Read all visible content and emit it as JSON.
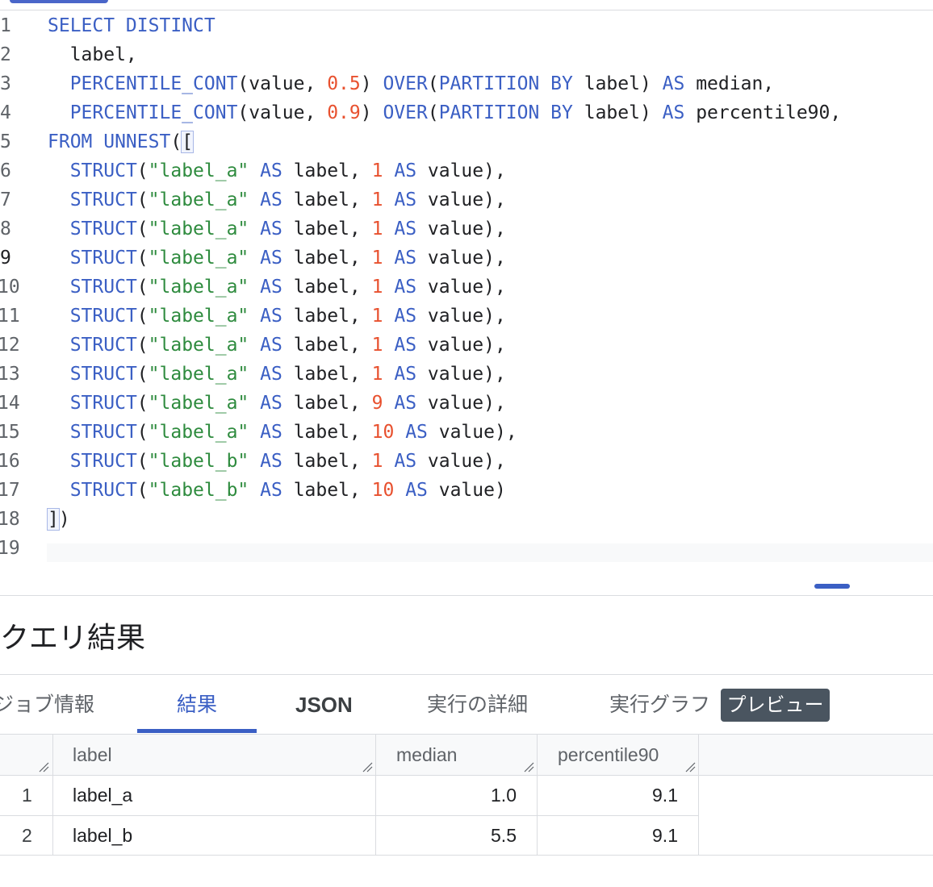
{
  "editor": {
    "line_numbers": [
      "1",
      "2",
      "3",
      "4",
      "5",
      "6",
      "7",
      "8",
      "9",
      "10",
      "11",
      "12",
      "13",
      "14",
      "15",
      "16",
      "17",
      "18",
      "19"
    ],
    "active_line": "9"
  },
  "results": {
    "title": "クエリ結果",
    "tabs": [
      {
        "label": "ジョブ情報"
      },
      {
        "label": "結果"
      },
      {
        "label": "JSON"
      },
      {
        "label": "実行の詳細"
      },
      {
        "label": "実行グラフ"
      }
    ],
    "preview_badge": "プレビュー",
    "columns": [
      "label",
      "median",
      "percentile90"
    ],
    "rows": [
      {
        "num": "1",
        "label": "label_a",
        "median": "1.0",
        "percentile90": "9.1"
      },
      {
        "num": "2",
        "label": "label_b",
        "median": "5.5",
        "percentile90": "9.1"
      }
    ]
  },
  "colors": {
    "keyword": "#3b5fc4",
    "number": "#e8512f",
    "string": "#2e8b3e",
    "accent": "#3b5fc4",
    "badge_bg": "#4a5560"
  },
  "code_lines": [
    [
      {
        "t": "kw",
        "v": "SELECT DISTINCT"
      }
    ],
    [
      {
        "t": "tx",
        "v": "  label,"
      }
    ],
    [
      {
        "t": "tx",
        "v": "  "
      },
      {
        "t": "kw",
        "v": "PERCENTILE_CONT"
      },
      {
        "t": "tx",
        "v": "(value, "
      },
      {
        "t": "num",
        "v": "0.5"
      },
      {
        "t": "tx",
        "v": ") "
      },
      {
        "t": "kw",
        "v": "OVER"
      },
      {
        "t": "tx",
        "v": "("
      },
      {
        "t": "kw",
        "v": "PARTITION BY"
      },
      {
        "t": "tx",
        "v": " label) "
      },
      {
        "t": "kw",
        "v": "AS"
      },
      {
        "t": "tx",
        "v": " median,"
      }
    ],
    [
      {
        "t": "tx",
        "v": "  "
      },
      {
        "t": "kw",
        "v": "PERCENTILE_CONT"
      },
      {
        "t": "tx",
        "v": "(value, "
      },
      {
        "t": "num",
        "v": "0.9"
      },
      {
        "t": "tx",
        "v": ") "
      },
      {
        "t": "kw",
        "v": "OVER"
      },
      {
        "t": "tx",
        "v": "("
      },
      {
        "t": "kw",
        "v": "PARTITION BY"
      },
      {
        "t": "tx",
        "v": " label) "
      },
      {
        "t": "kw",
        "v": "AS"
      },
      {
        "t": "tx",
        "v": " percentile90,"
      }
    ],
    [
      {
        "t": "kw",
        "v": "FROM UNNEST"
      },
      {
        "t": "tx",
        "v": "("
      },
      {
        "t": "br",
        "v": "["
      }
    ],
    [
      {
        "t": "tx",
        "v": "  "
      },
      {
        "t": "kw",
        "v": "STRUCT"
      },
      {
        "t": "tx",
        "v": "("
      },
      {
        "t": "str",
        "v": "\"label_a\""
      },
      {
        "t": "tx",
        "v": " "
      },
      {
        "t": "kw",
        "v": "AS"
      },
      {
        "t": "tx",
        "v": " label, "
      },
      {
        "t": "num",
        "v": "1"
      },
      {
        "t": "tx",
        "v": " "
      },
      {
        "t": "kw",
        "v": "AS"
      },
      {
        "t": "tx",
        "v": " value),"
      }
    ],
    [
      {
        "t": "tx",
        "v": "  "
      },
      {
        "t": "kw",
        "v": "STRUCT"
      },
      {
        "t": "tx",
        "v": "("
      },
      {
        "t": "str",
        "v": "\"label_a\""
      },
      {
        "t": "tx",
        "v": " "
      },
      {
        "t": "kw",
        "v": "AS"
      },
      {
        "t": "tx",
        "v": " label, "
      },
      {
        "t": "num",
        "v": "1"
      },
      {
        "t": "tx",
        "v": " "
      },
      {
        "t": "kw",
        "v": "AS"
      },
      {
        "t": "tx",
        "v": " value),"
      }
    ],
    [
      {
        "t": "tx",
        "v": "  "
      },
      {
        "t": "kw",
        "v": "STRUCT"
      },
      {
        "t": "tx",
        "v": "("
      },
      {
        "t": "str",
        "v": "\"label_a\""
      },
      {
        "t": "tx",
        "v": " "
      },
      {
        "t": "kw",
        "v": "AS"
      },
      {
        "t": "tx",
        "v": " label, "
      },
      {
        "t": "num",
        "v": "1"
      },
      {
        "t": "tx",
        "v": " "
      },
      {
        "t": "kw",
        "v": "AS"
      },
      {
        "t": "tx",
        "v": " value),"
      }
    ],
    [
      {
        "t": "tx",
        "v": "  "
      },
      {
        "t": "kw",
        "v": "STRUCT"
      },
      {
        "t": "tx",
        "v": "("
      },
      {
        "t": "str",
        "v": "\"label_a\""
      },
      {
        "t": "tx",
        "v": " "
      },
      {
        "t": "kw",
        "v": "AS"
      },
      {
        "t": "tx",
        "v": " label, "
      },
      {
        "t": "num",
        "v": "1"
      },
      {
        "t": "tx",
        "v": " "
      },
      {
        "t": "kw",
        "v": "AS"
      },
      {
        "t": "tx",
        "v": " value),"
      }
    ],
    [
      {
        "t": "tx",
        "v": "  "
      },
      {
        "t": "kw",
        "v": "STRUCT"
      },
      {
        "t": "tx",
        "v": "("
      },
      {
        "t": "str",
        "v": "\"label_a\""
      },
      {
        "t": "tx",
        "v": " "
      },
      {
        "t": "kw",
        "v": "AS"
      },
      {
        "t": "tx",
        "v": " label, "
      },
      {
        "t": "num",
        "v": "1"
      },
      {
        "t": "tx",
        "v": " "
      },
      {
        "t": "kw",
        "v": "AS"
      },
      {
        "t": "tx",
        "v": " value),"
      }
    ],
    [
      {
        "t": "tx",
        "v": "  "
      },
      {
        "t": "kw",
        "v": "STRUCT"
      },
      {
        "t": "tx",
        "v": "("
      },
      {
        "t": "str",
        "v": "\"label_a\""
      },
      {
        "t": "tx",
        "v": " "
      },
      {
        "t": "kw",
        "v": "AS"
      },
      {
        "t": "tx",
        "v": " label, "
      },
      {
        "t": "num",
        "v": "1"
      },
      {
        "t": "tx",
        "v": " "
      },
      {
        "t": "kw",
        "v": "AS"
      },
      {
        "t": "tx",
        "v": " value),"
      }
    ],
    [
      {
        "t": "tx",
        "v": "  "
      },
      {
        "t": "kw",
        "v": "STRUCT"
      },
      {
        "t": "tx",
        "v": "("
      },
      {
        "t": "str",
        "v": "\"label_a\""
      },
      {
        "t": "tx",
        "v": " "
      },
      {
        "t": "kw",
        "v": "AS"
      },
      {
        "t": "tx",
        "v": " label, "
      },
      {
        "t": "num",
        "v": "1"
      },
      {
        "t": "tx",
        "v": " "
      },
      {
        "t": "kw",
        "v": "AS"
      },
      {
        "t": "tx",
        "v": " value),"
      }
    ],
    [
      {
        "t": "tx",
        "v": "  "
      },
      {
        "t": "kw",
        "v": "STRUCT"
      },
      {
        "t": "tx",
        "v": "("
      },
      {
        "t": "str",
        "v": "\"label_a\""
      },
      {
        "t": "tx",
        "v": " "
      },
      {
        "t": "kw",
        "v": "AS"
      },
      {
        "t": "tx",
        "v": " label, "
      },
      {
        "t": "num",
        "v": "1"
      },
      {
        "t": "tx",
        "v": " "
      },
      {
        "t": "kw",
        "v": "AS"
      },
      {
        "t": "tx",
        "v": " value),"
      }
    ],
    [
      {
        "t": "tx",
        "v": "  "
      },
      {
        "t": "kw",
        "v": "STRUCT"
      },
      {
        "t": "tx",
        "v": "("
      },
      {
        "t": "str",
        "v": "\"label_a\""
      },
      {
        "t": "tx",
        "v": " "
      },
      {
        "t": "kw",
        "v": "AS"
      },
      {
        "t": "tx",
        "v": " label, "
      },
      {
        "t": "num",
        "v": "9"
      },
      {
        "t": "tx",
        "v": " "
      },
      {
        "t": "kw",
        "v": "AS"
      },
      {
        "t": "tx",
        "v": " value),"
      }
    ],
    [
      {
        "t": "tx",
        "v": "  "
      },
      {
        "t": "kw",
        "v": "STRUCT"
      },
      {
        "t": "tx",
        "v": "("
      },
      {
        "t": "str",
        "v": "\"label_a\""
      },
      {
        "t": "tx",
        "v": " "
      },
      {
        "t": "kw",
        "v": "AS"
      },
      {
        "t": "tx",
        "v": " label, "
      },
      {
        "t": "num",
        "v": "10"
      },
      {
        "t": "tx",
        "v": " "
      },
      {
        "t": "kw",
        "v": "AS"
      },
      {
        "t": "tx",
        "v": " value),"
      }
    ],
    [
      {
        "t": "tx",
        "v": "  "
      },
      {
        "t": "kw",
        "v": "STRUCT"
      },
      {
        "t": "tx",
        "v": "("
      },
      {
        "t": "str",
        "v": "\"label_b\""
      },
      {
        "t": "tx",
        "v": " "
      },
      {
        "t": "kw",
        "v": "AS"
      },
      {
        "t": "tx",
        "v": " label, "
      },
      {
        "t": "num",
        "v": "1"
      },
      {
        "t": "tx",
        "v": " "
      },
      {
        "t": "kw",
        "v": "AS"
      },
      {
        "t": "tx",
        "v": " value),"
      }
    ],
    [
      {
        "t": "tx",
        "v": "  "
      },
      {
        "t": "kw",
        "v": "STRUCT"
      },
      {
        "t": "tx",
        "v": "("
      },
      {
        "t": "str",
        "v": "\"label_b\""
      },
      {
        "t": "tx",
        "v": " "
      },
      {
        "t": "kw",
        "v": "AS"
      },
      {
        "t": "tx",
        "v": " label, "
      },
      {
        "t": "num",
        "v": "10"
      },
      {
        "t": "tx",
        "v": " "
      },
      {
        "t": "kw",
        "v": "AS"
      },
      {
        "t": "tx",
        "v": " value)"
      }
    ],
    [
      {
        "t": "br",
        "v": "]"
      },
      {
        "t": "tx",
        "v": ")"
      }
    ],
    []
  ]
}
